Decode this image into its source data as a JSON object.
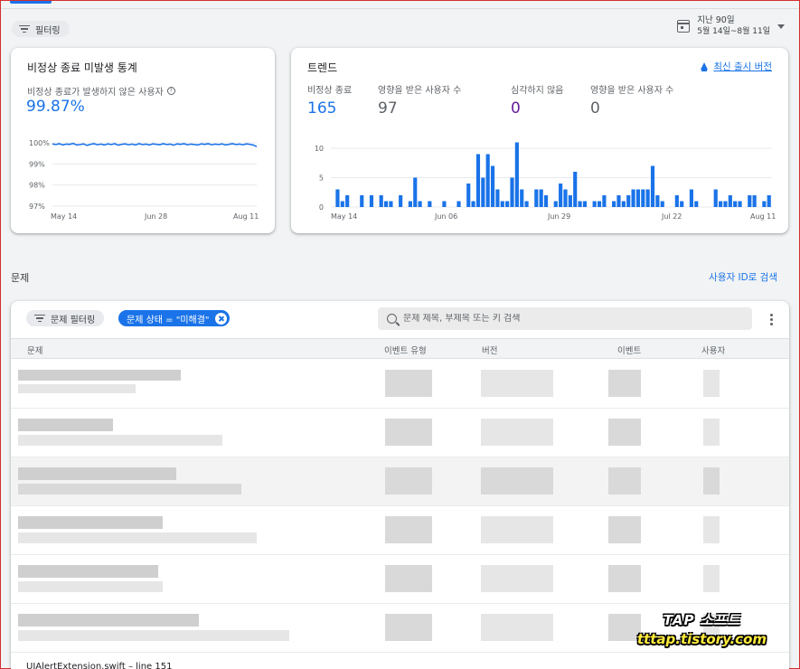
{
  "toolbar": {
    "filter_label": "필터링"
  },
  "date_range": {
    "title": "지난 90일",
    "range": "5월 14일~8월 11일"
  },
  "crash_free": {
    "title": "비정상 종료 미발생 통계",
    "subtitle": "비정상 종료가 발생하지 않은 사용자",
    "value": "99.87%",
    "y_ticks": [
      "100%",
      "99%",
      "98%",
      "97%"
    ],
    "x_ticks": [
      "May 14",
      "Jun 28",
      "Aug 11"
    ]
  },
  "trend": {
    "title": "트렌드",
    "latest_release_label": "최신 출시 버전",
    "metrics": [
      {
        "label": "비정상 종료",
        "value": "165",
        "color": "#1a73e8"
      },
      {
        "label": "영향을 받은 사용자 수",
        "value": "97",
        "color": "#5f6368"
      },
      {
        "label": "심각하지 않음",
        "value": "0",
        "color": "#6a1b9a"
      },
      {
        "label": "영향을 받은 사용자 수",
        "value": "0",
        "color": "#5f6368"
      }
    ],
    "y_ticks": [
      "10",
      "5",
      "0"
    ],
    "x_ticks": [
      "May 14",
      "Jun 06",
      "Jun 29",
      "Jul 22",
      "Aug 11"
    ]
  },
  "chart_data": [
    {
      "type": "line",
      "title": "비정상 종료 미발생 통계",
      "ylim": [
        97,
        100
      ],
      "x_ticks": [
        "May 14",
        "Jun 28",
        "Aug 11"
      ],
      "series": [
        {
          "values": [
            99.95,
            99.92,
            99.96,
            99.9,
            99.94,
            99.93,
            99.97,
            99.9,
            99.92,
            99.95,
            99.88,
            99.93,
            99.96,
            99.91,
            99.94,
            99.9,
            99.95,
            99.92,
            99.96,
            99.89,
            99.93,
            99.95,
            99.91,
            99.94,
            99.9,
            99.96,
            99.92,
            99.94,
            99.9,
            99.95,
            99.93,
            99.91,
            99.96,
            99.92,
            99.94,
            99.89,
            99.95,
            99.93,
            99.96,
            99.91,
            99.94,
            99.92,
            99.9,
            99.95,
            99.93,
            99.96,
            99.91,
            99.94,
            99.92,
            99.95,
            99.9,
            99.93,
            99.96,
            99.92,
            99.94,
            99.91,
            99.95,
            99.93,
            99.9,
            99.82
          ]
        }
      ]
    },
    {
      "type": "bar",
      "title": "트렌드",
      "ylim": [
        0,
        10
      ],
      "x_ticks": [
        "May 14",
        "Jun 06",
        "Jun 29",
        "Jul 22",
        "Aug 11"
      ],
      "series": [
        {
          "values": [
            0,
            3,
            1,
            2,
            0,
            0,
            2,
            0,
            2,
            0,
            2,
            1,
            1,
            0,
            2,
            0,
            1,
            5,
            1,
            0,
            1,
            0,
            0,
            1,
            0,
            0,
            1,
            0,
            4,
            1,
            9,
            5,
            9,
            7,
            3,
            1,
            1,
            5,
            11,
            3,
            1,
            0,
            3,
            3,
            2,
            0,
            1,
            4,
            3,
            2,
            6,
            1,
            1,
            0,
            1,
            1,
            2,
            0,
            1,
            2,
            1,
            2,
            3,
            3,
            3,
            3,
            7,
            2,
            1,
            0,
            0,
            2,
            1,
            0,
            3,
            1,
            0,
            0,
            0,
            3,
            1,
            1,
            2,
            1,
            1,
            0,
            2,
            2,
            0,
            1,
            2
          ]
        }
      ]
    }
  ],
  "issues": {
    "section_title": "문제",
    "search_by_id": "사용자 ID로 검색",
    "filter_chip": "문제 필터링",
    "status_chip": "문제 상태 = \"미해결\"",
    "search_placeholder": "문제 제목, 부제목 또는 키 검색",
    "columns": [
      "문제",
      "이벤트 유형",
      "버전",
      "이벤트",
      "사용자"
    ],
    "last_row_title": "UIAlertExtension.swift – line 151"
  },
  "watermark": {
    "line1": "TAP 소프트",
    "line2": "tttap.tistory.com"
  }
}
